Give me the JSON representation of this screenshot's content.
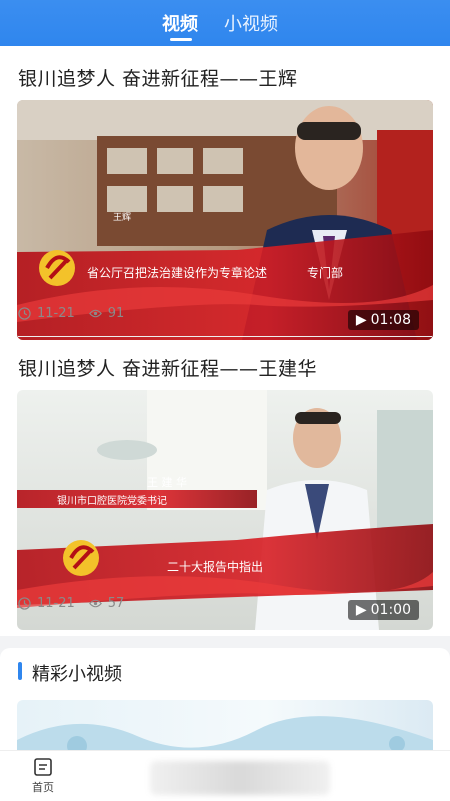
{
  "header": {
    "tabs": [
      {
        "label": "视频",
        "active": true
      },
      {
        "label": "小视频",
        "active": false
      }
    ]
  },
  "videos": [
    {
      "title": "银川追梦人  奋进新征程——王辉",
      "date": "11-21",
      "views": "91",
      "duration": "01:08",
      "name_caption": "王辉",
      "subtitle_caption": "省公厅召把法治建设作为专章论述",
      "suffix_caption": "专门部"
    },
    {
      "title": "银川追梦人  奋进新征程——王建华",
      "date": "11-21",
      "views": "57",
      "duration": "01:00",
      "name_caption": "王 建 华",
      "role_caption": "银川市口腔医院党委书记",
      "subtitle_caption": "二十大报告中指出"
    }
  ],
  "section2": {
    "title": "精彩小视频"
  },
  "nav": {
    "home_label": "首页"
  },
  "colors": {
    "primary": "#2f86ee",
    "red_banner": "#c8141c"
  }
}
